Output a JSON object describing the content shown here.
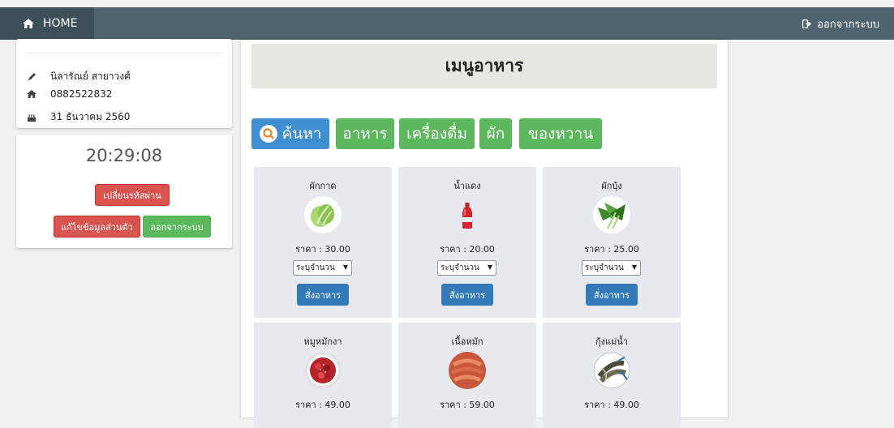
{
  "topbar": {
    "home_label": "HOME",
    "logout_label": "ออกจากระบบ",
    "home_icon": "home-icon",
    "logout_icon": "sign-out-icon"
  },
  "profile": {
    "name": "นิลารัณย์ สายาวงศ์",
    "phone": "0882522832",
    "date": "31 ธันวาคม 2560"
  },
  "clock": {
    "time": "20:29:08",
    "change_password_label": "เปลี่ยนรหัสผ่าน",
    "edit_profile_label": "แก้ไขข้อมูลส่วนตัว",
    "logout_label": "ออกจากระบบ"
  },
  "menu": {
    "title": "เมนูอาหาร",
    "search_label": "ค้นหา",
    "categories": [
      "อาหาร",
      "เครื่องดื่ม",
      "ผัก",
      "ของหวาน"
    ],
    "items": [
      {
        "name": "ผักกาด",
        "price": "ราคา : 30.00",
        "qty_placeholder": "ระบุจำนวน",
        "order_label": "สั่งอาหาร",
        "icon": "lettuce-icon"
      },
      {
        "name": "น้ำแดง",
        "price": "ราคา : 20.00",
        "qty_placeholder": "ระบุจำนวน",
        "order_label": "สั่งอาหาร",
        "icon": "red-soda-bottle-icon"
      },
      {
        "name": "ผักบุ้ง",
        "price": "ราคา : 25.00",
        "qty_placeholder": "ระบุจำนวน",
        "order_label": "สั่งอาหาร",
        "icon": "morning-glory-icon"
      },
      {
        "name": "หมูหมักงา",
        "price": "ราคา : 49.00",
        "icon": "marinated-pork-icon"
      },
      {
        "name": "เนื้อหมัก",
        "price": "ราคา : 59.00",
        "icon": "marinated-beef-icon"
      },
      {
        "name": "กุ้งแม่น้ำ",
        "price": "ราคา : 49.00",
        "icon": "river-prawn-icon"
      }
    ]
  },
  "colors": {
    "topbar": "#4f6470",
    "home_bg": "#3d4f59",
    "danger": "#d9534f",
    "success": "#5cb85c",
    "primary": "#337ab7",
    "search": "#3d8fd1",
    "card_bg": "#e6e9ee",
    "header_bg": "#e5e9e2"
  }
}
